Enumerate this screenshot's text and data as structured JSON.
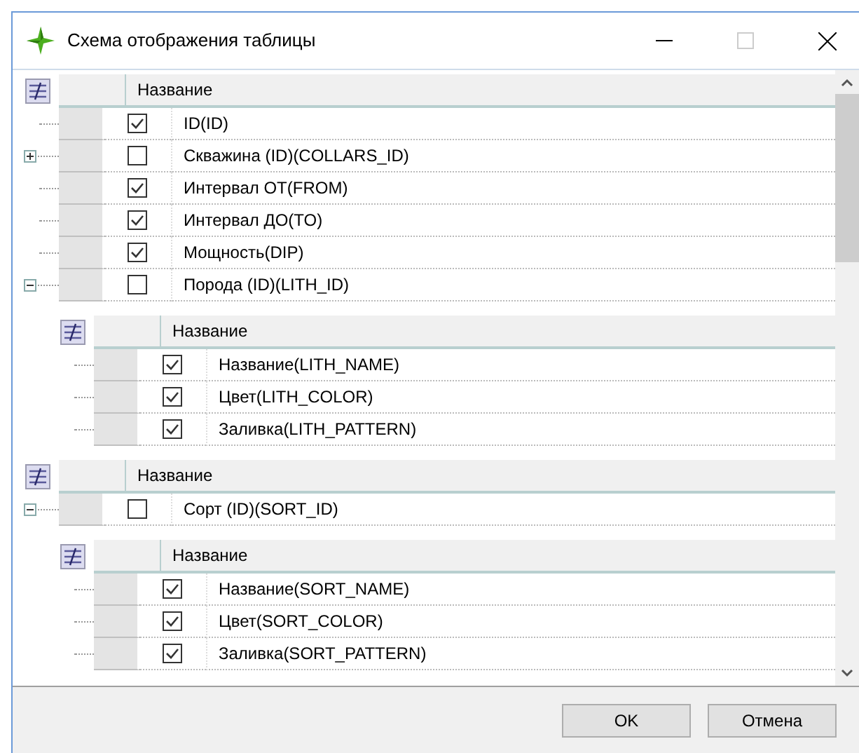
{
  "window": {
    "title": "Схема отображения таблицы"
  },
  "bands": [
    {
      "header": "Название",
      "rows": [
        {
          "kind": "leaf",
          "label": "ID(ID)",
          "checked": true
        },
        {
          "kind": "group",
          "label": "Скважина (ID)(COLLARS_ID)",
          "checked": false,
          "expanded": false
        },
        {
          "kind": "leaf",
          "label": "Интервал ОТ(FROM)",
          "checked": true
        },
        {
          "kind": "leaf",
          "label": "Интервал ДО(TO)",
          "checked": true
        },
        {
          "kind": "leaf",
          "label": "Мощность(DIP)",
          "checked": true
        },
        {
          "kind": "group",
          "label": "Порода (ID)(LITH_ID)",
          "checked": false,
          "expanded": true,
          "detail": {
            "header": "Название",
            "rows": [
              {
                "label": "Название(LITH_NAME)",
                "checked": true
              },
              {
                "label": "Цвет(LITH_COLOR)",
                "checked": true
              },
              {
                "label": "Заливка(LITH_PATTERN)",
                "checked": true
              }
            ]
          }
        }
      ]
    },
    {
      "header": "Название",
      "rows": [
        {
          "kind": "group",
          "label": "Сорт (ID)(SORT_ID)",
          "checked": false,
          "expanded": true,
          "detail": {
            "header": "Название",
            "rows": [
              {
                "label": "Название(SORT_NAME)",
                "checked": true
              },
              {
                "label": "Цвет(SORT_COLOR)",
                "checked": true
              },
              {
                "label": "Заливка(SORT_PATTERN)",
                "checked": true
              }
            ]
          }
        }
      ]
    }
  ],
  "buttons": [
    {
      "label": "OK"
    },
    {
      "label": "Отмена"
    }
  ]
}
